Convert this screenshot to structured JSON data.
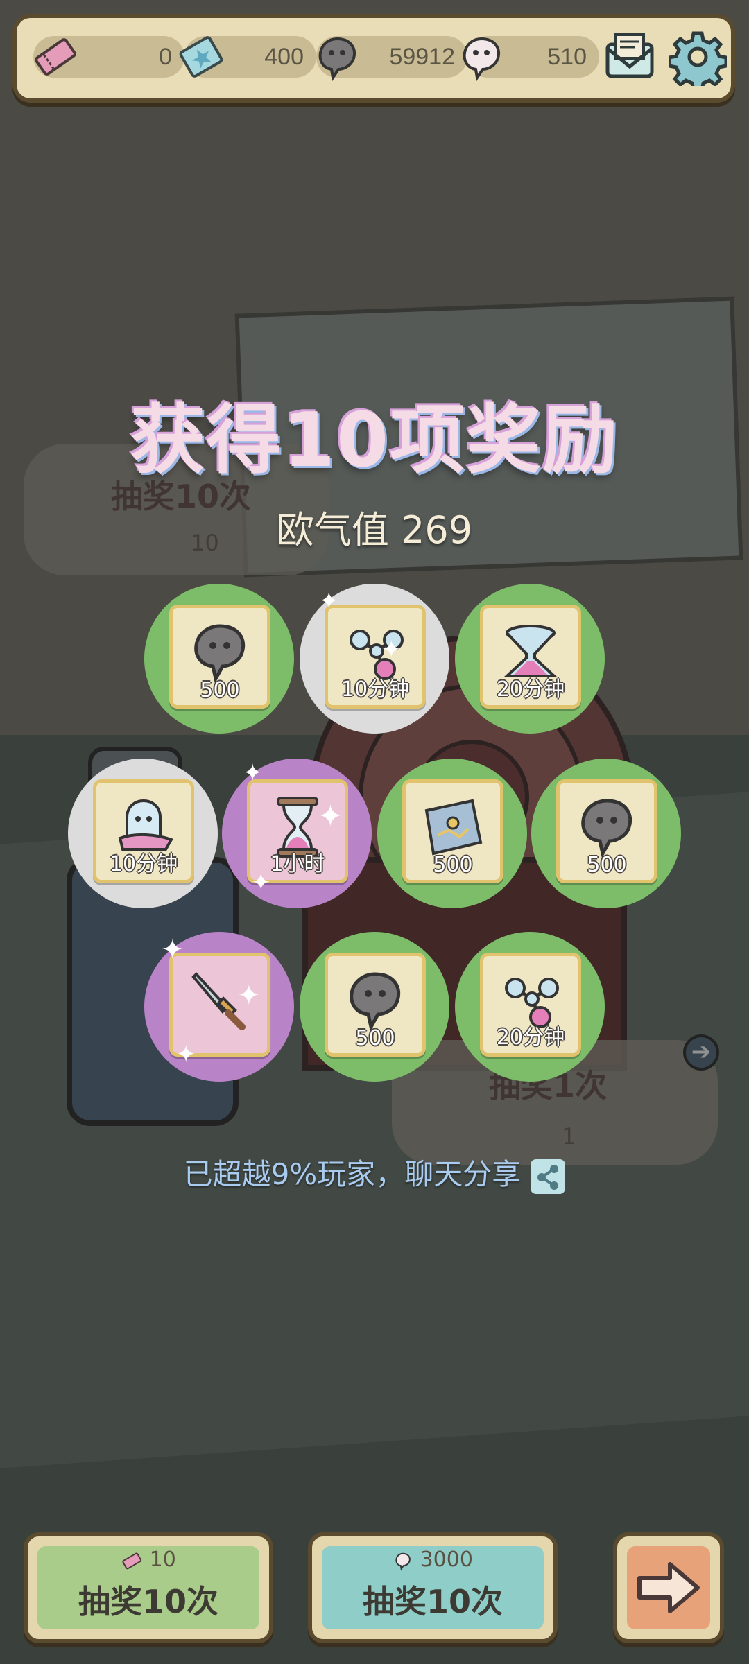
{
  "top_bar": {
    "tickets": "0",
    "stars": "400",
    "gray_souls": "59912",
    "white_souls": "510"
  },
  "background": {
    "draw10_label": "抽奖10次",
    "draw10_cost": "10",
    "draw1_label": "抽奖1次",
    "draw1_cost": "1"
  },
  "reward_panel": {
    "title": "获得10项奖励",
    "luck_label": "欧气值 269",
    "rewards": [
      {
        "item": "gray-soul",
        "label": "500",
        "rarity": "green"
      },
      {
        "item": "molecule",
        "label": "10分钟",
        "rarity": "white"
      },
      {
        "item": "funnel",
        "label": "20分钟",
        "rarity": "green"
      },
      {
        "item": "ghost-cloth",
        "label": "10分钟",
        "rarity": "white"
      },
      {
        "item": "hourglass",
        "label": "1小时",
        "rarity": "purple"
      },
      {
        "item": "map-scroll",
        "label": "500",
        "rarity": "green"
      },
      {
        "item": "gray-soul",
        "label": "500",
        "rarity": "green"
      },
      {
        "item": "dagger",
        "label": "",
        "rarity": "purple"
      },
      {
        "item": "gray-soul",
        "label": "500",
        "rarity": "green"
      },
      {
        "item": "molecule",
        "label": "20分钟",
        "rarity": "green"
      }
    ],
    "share_text": "已超越9%玩家，聊天分享"
  },
  "bottom": {
    "draw10_ticket_cost": "10",
    "draw10_ticket_label": "抽奖10次",
    "draw10_soul_cost": "3000",
    "draw10_soul_label": "抽奖10次"
  },
  "colors": {
    "green": "#7dbd6a",
    "white": "#dcdcdc",
    "purple": "#b983c7",
    "frame": "#5a4a2e"
  }
}
